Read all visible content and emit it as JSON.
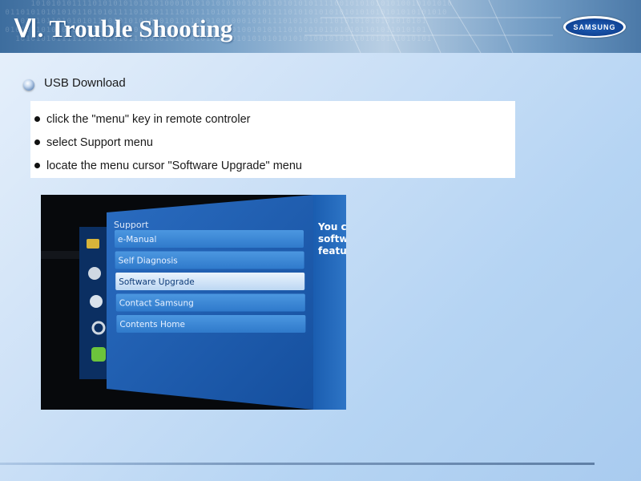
{
  "header": {
    "title": "Ⅵ. Trouble Shooting",
    "logo_text": "SAMSUNG"
  },
  "section": {
    "heading": "USB Download"
  },
  "steps": [
    "click the \"menu\" key in remote controler",
    "select Support menu",
    "locate the menu cursor \"Software Upgrade\" menu"
  ],
  "tv_menu": {
    "header": "Support",
    "items": [
      "e-Manual",
      "Self Diagnosis",
      "Software Upgrade",
      "Contact Samsung",
      "Contents Home"
    ],
    "selected_index": 2,
    "side_text": [
      "You ca",
      "softwa",
      "featur"
    ]
  },
  "colors": {
    "menu_panel": "#1f5fb2",
    "menu_item": "#3a86d6",
    "selected_item": "#d4e6fa",
    "title_text": "#ffffff"
  }
}
